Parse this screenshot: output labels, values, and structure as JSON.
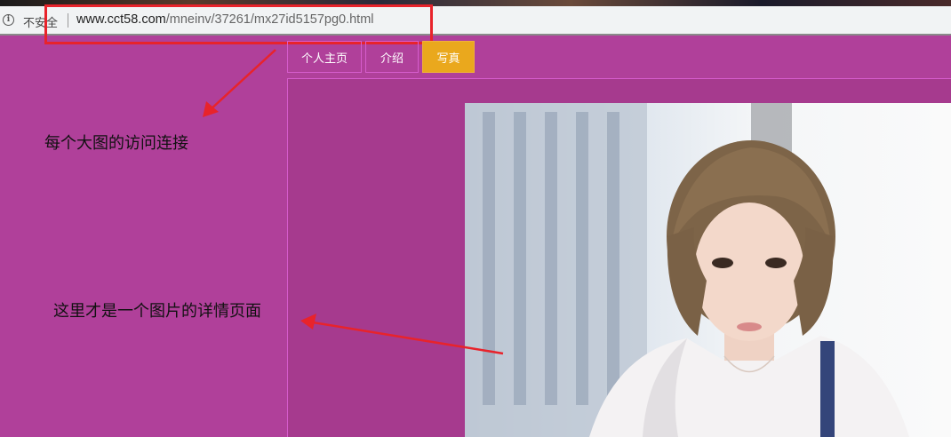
{
  "browser": {
    "security_label": "不安全",
    "url_domain": "www.cct58.com",
    "url_path": "/mneinv/37261/mx27id5157pg0.html"
  },
  "nav": {
    "items": [
      {
        "label": "个人主页",
        "active": false
      },
      {
        "label": "介绍",
        "active": false
      },
      {
        "label": "写真",
        "active": true
      }
    ]
  },
  "annotations": {
    "top_note": "每个大图的访问连接",
    "middle_note": "这里才是一个图片的详情页面"
  },
  "colors": {
    "page_bg": "#b0409a",
    "content_bg": "#a63a8e",
    "active_tab": "#eaa81d",
    "annotation_red": "#e8232b"
  },
  "icons": [
    "info-icon"
  ]
}
